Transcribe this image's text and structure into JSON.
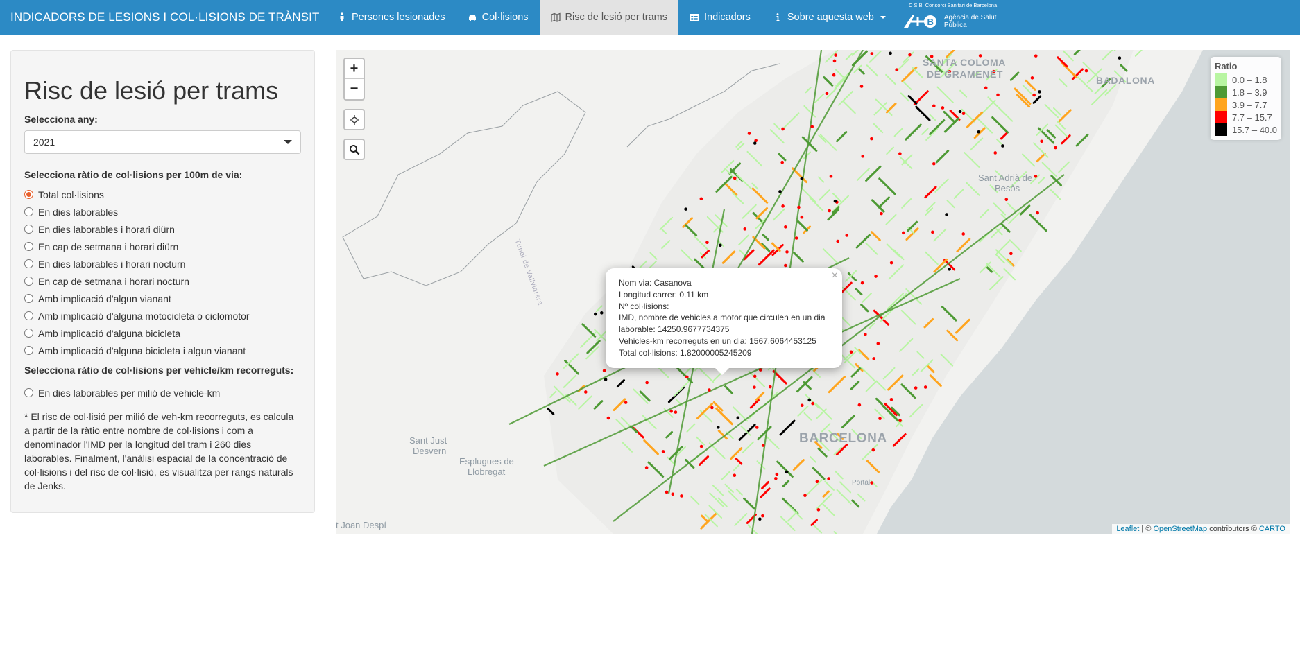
{
  "nav": {
    "brand": "INDICADORS DE LESIONS I COL·LISIONS DE TRÀNSIT",
    "items": [
      {
        "label": "Persones lesionades",
        "icon": "person-icon",
        "active": false
      },
      {
        "label": "Col·lisions",
        "icon": "car-icon",
        "active": false
      },
      {
        "label": "Risc de lesió per trams",
        "icon": "map-icon",
        "active": true
      },
      {
        "label": "Indicadors",
        "icon": "table-icon",
        "active": false
      },
      {
        "label": "Sobre aquesta web",
        "icon": "info-icon",
        "active": false
      }
    ],
    "logo_top": "Consorci Sanitari de Barcelona",
    "logo_csb": "C S B",
    "logo_name": "Agència de Salut Pública"
  },
  "sidebar": {
    "title": "Risc de lesió per trams",
    "year_label": "Selecciona any:",
    "year_value": "2021",
    "ratio100_label": "Selecciona ràtio de col·lisions per 100m de via:",
    "ratio100_options": [
      "Total col·lisions",
      "En dies laborables",
      "En dies laborables i horari diürn",
      "En cap de setmana i horari diürn",
      "En dies laborables i horari nocturn",
      "En cap de setmana i horari nocturn",
      "Amb implicació d'algun vianant",
      "Amb implicació d'alguna motocicleta o ciclomotor",
      "Amb implicació d'alguna bicicleta",
      "Amb implicació d'alguna bicicleta i algun vianant"
    ],
    "selected_option": "Total col·lisions",
    "ratiovkm_label": "Selecciona ràtio de col·lisions per vehicle/km recorreguts:",
    "ratiovkm_options": [
      "En dies laborables per milió de vehicle-km"
    ],
    "note": "* El risc de col·lisió per milió de veh-km recorreguts, es calcula a partir de la ràtio entre nombre de col·lisions i com a denominador l'IMD per la longitud del tram i 260 dies laborables. Finalment, l'anàlisi espacial de la concentració de col·lisions i del risc de col·lisió, es visualitza per rangs naturals de Jenks."
  },
  "map": {
    "zoom_in": "+",
    "zoom_out": "−",
    "legend": {
      "title": "Ratio",
      "classes": [
        {
          "label": "0.0 – 1.8",
          "color": "#b8f5a2"
        },
        {
          "label": "1.8 – 3.9",
          "color": "#4e9a35"
        },
        {
          "label": "3.9 – 7.7",
          "color": "#ffa51f"
        },
        {
          "label": "7.7 – 15.7",
          "color": "#ff0000"
        },
        {
          "label": "15.7 – 40.0",
          "color": "#000000"
        }
      ]
    },
    "popup": {
      "lines": [
        "Nom via: Casanova",
        "Longitud carrer: 0.11 km",
        "Nº col·lisions:",
        "IMD, nombre de vehicles a motor que circulen en un dia laborable: 14250.9677734375",
        "Vehicles-km recorreguts en un dia: 1567.6064453125",
        "Total col·lisions: 1.82000005245209"
      ],
      "close": "×"
    },
    "place_labels": {
      "santa_coloma": "SANTA COLOMA",
      "gramenet": "DE GRAMENET",
      "badalona": "BADALONA",
      "sant_adria": "Sant Adrià de",
      "besos": "Besòs",
      "barcelona": "BARCELONA",
      "sant_just": "Sant Just",
      "desvern": "Desvern",
      "esplugues": "Esplugues de",
      "llobregat": "Llobregat",
      "sant_joan": "t Joan Despí",
      "tunel": "Túnel de Vallvidrera",
      "port": "Portal"
    },
    "attribution": {
      "leaflet": "Leaflet",
      "sep1": " | © ",
      "osm": "OpenStreetMap",
      "mid": " contributors © ",
      "carto": "CARTO"
    }
  }
}
